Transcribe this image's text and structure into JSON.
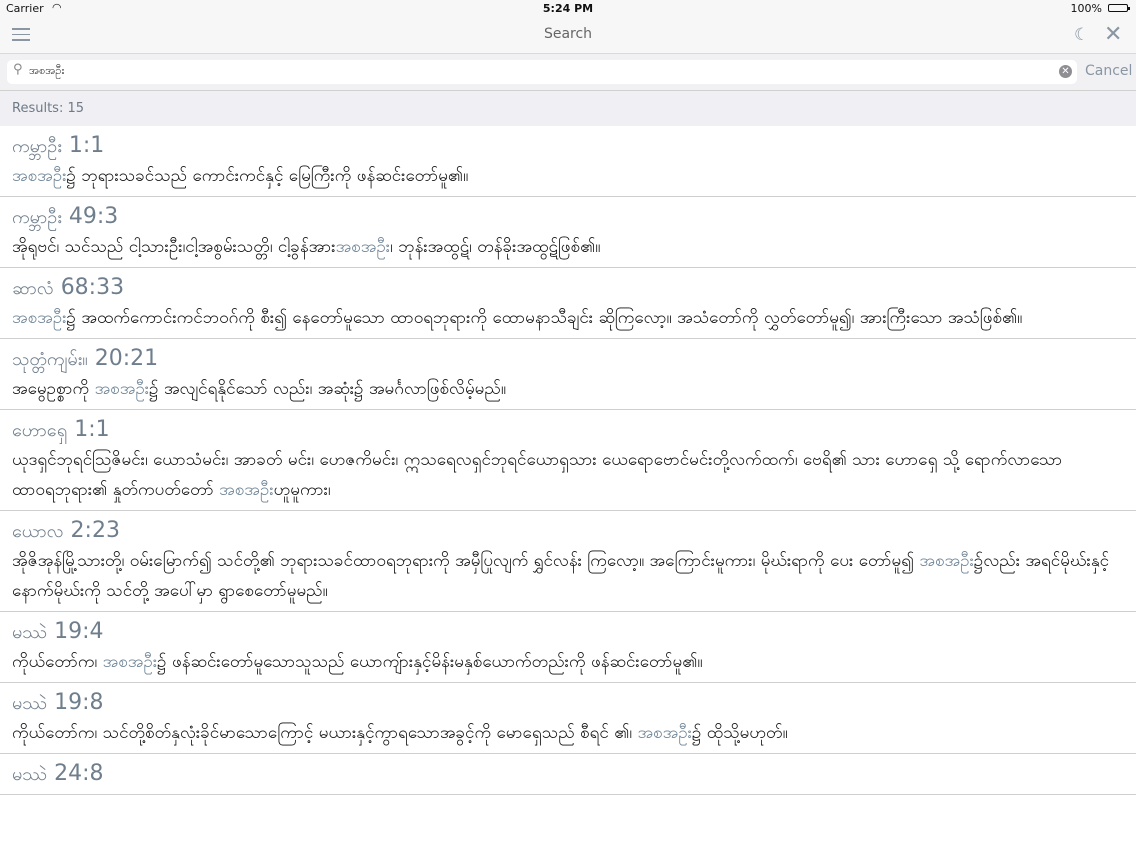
{
  "status": {
    "carrier": "Carrier",
    "time": "5:24 PM",
    "battery": "100%"
  },
  "nav": {
    "title": "Search"
  },
  "search": {
    "query": "အစအဦး",
    "cancel": "Cancel"
  },
  "results_label": "Results: 15",
  "results": [
    {
      "book": "ကမ္ဘာဦး",
      "ref": "1:1",
      "pre": "",
      "hl": "အစအဦး",
      "post": "၌ ဘုရားသခင်သည် ကောင်းကင်နှင့် မြေကြီးကို ဖန်ဆင်းတော်မူ၏။"
    },
    {
      "book": "ကမ္ဘာဦး",
      "ref": "49:3",
      "pre": "အိုရုဗင်၊ သင်သည် ငါ့သားဦး၊ငါ့အစွမ်းသတ္တိ၊ ငါ့ခွန်အား",
      "hl": "အစအဦး",
      "post": "၊ ဘုန်းအထွဋ်၊ တန်ခိုးအထွဋ်ဖြစ်၏။"
    },
    {
      "book": "ဆာလံ",
      "ref": "68:33",
      "pre": "",
      "hl": "အစအဦး",
      "post": "၌ အထက်ကောင်းကင်ဘဝဂ်ကို စီး၍ နေတော်မူသော ထာဝရဘုရားကို ထောမနာသီချင်း ဆိုကြလော့။ အသံတော်ကို လွှတ်တော်မူ၍၊ အားကြီးသော အသံဖြစ်၏။"
    },
    {
      "book": "သုတ္တံကျမ်း။",
      "ref": "20:21",
      "pre": "အမွေဥစ္စာကို ",
      "hl": "အစအဦး",
      "post": "၌ အလျင်ရနိုင်သော် လည်း၊ အဆုံး၌ အမင်္ဂလာဖြစ်လိမ့်မည်။"
    },
    {
      "book": "ဟောရှေ",
      "ref": "1:1",
      "pre": "ယုဒရှင်ဘုရင်ဩဇိမင်း၊ ယောသံမင်း၊ အာခတ် မင်း၊ ဟေဇကိမင်း၊ ဣသရေလရှင်ဘုရင်ယောရှသား ယေရောဗောင်မင်းတို့လက်ထက်၊ ဗေရိ၏ သား ဟောရှေ သို့ ရောက်လာသောထာဝရဘုရား၏ နှုတ်ကပတ်တော် ",
      "hl": "အစအဦး",
      "post": "ဟူမူကား၊"
    },
    {
      "book": "ယောလ",
      "ref": "2:23",
      "pre": "အိုဇိအုန်မြို့သားတို့၊ ဝမ်းမြောက်၍ သင်တို့၏ ဘုရားသခင်ထာဝရဘုရားကို အမှီပြုလျက် ရွှင်လန်း ကြလော့။ အကြောင်းမူကား၊ မိုဃ်းရာကို ပေး တော်မူ၍ ",
      "hl": "အစအဦး",
      "post": "၌လည်း အရင်မိုဃ်းနှင့်နောက်မိုဃ်းကို သင်တို့ အပေါ်မှာ ရွာစေတော်မူမည်။"
    },
    {
      "book": "မဿဲ",
      "ref": "19:4",
      "pre": "ကိုယ်တော်က၊ ",
      "hl": "အစအဦး",
      "post": "၌ ဖန်ဆင်းတော်မူသောသူသည် ယောကျ်ားနှင့်မိန်းမနှစ်ယောက်တည်းကို ဖန်ဆင်းတော်မူ၏။"
    },
    {
      "book": "မဿဲ",
      "ref": "19:8",
      "pre": "ကိုယ်တော်က၊ သင်တို့စိတ်နှလုံးခိုင်မာသောကြောင့် မယားနှင့်ကွာရသောအခွင့်ကို မောရှေသည် စီရင် ၏၊ ",
      "hl": "အစအဦး",
      "post": "၌ ထိုသို့မဟုတ်။"
    },
    {
      "book": "မဿဲ",
      "ref": "24:8",
      "pre": "",
      "hl": "",
      "post": ""
    }
  ]
}
